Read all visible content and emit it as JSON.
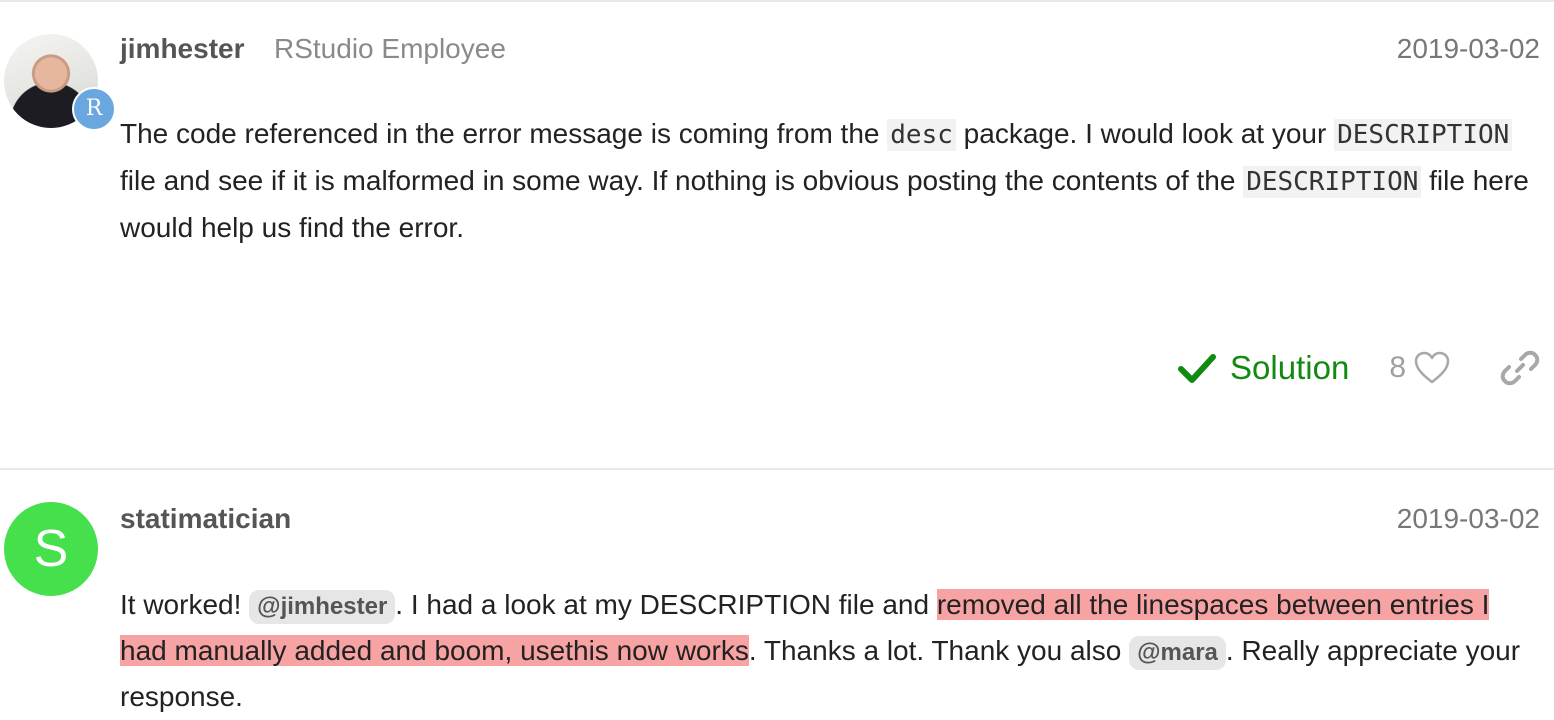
{
  "posts": [
    {
      "username": "jimhester",
      "title": "RStudio Employee",
      "date": "2019-03-02",
      "avatar_badge": "R",
      "body": {
        "p1": "The code referenced in the error message is coming from the ",
        "code1": "desc",
        "p2": " package. I would look at your ",
        "code2": "DESCRIPTION",
        "p3": " file and see if it is malformed in some way. If nothing is obvious posting the contents of the ",
        "code3": "DESCRIPTION",
        "p4": " file here would help us find the error."
      },
      "actions": {
        "solution_label": "Solution",
        "like_count": "8",
        "icons": [
          "check-icon",
          "heart-icon",
          "link-icon"
        ]
      }
    },
    {
      "username": "statimatician",
      "date": "2019-03-02",
      "avatar_letter": "S",
      "avatar_color": "#45e04b",
      "body": {
        "p1": "It worked! ",
        "mention1": "@jimhester",
        "p2": ". I had a look at my DESCRIPTION file and ",
        "highlight": "removed all the linespaces between entries I had manually added and boom, usethis now works",
        "p3": ". Thanks a lot. Thank you also ",
        "mention2": "@mara",
        "p4": ". Really appreciate your response."
      }
    }
  ],
  "colors": {
    "solution_green": "#118a11",
    "highlight": "#f7a3a3",
    "badge_blue": "#6aa6e0"
  }
}
